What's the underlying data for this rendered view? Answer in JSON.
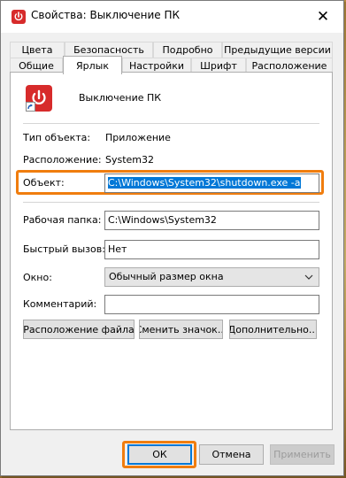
{
  "window": {
    "title": "Свойства: Выключение ПК",
    "close_glyph": "✕"
  },
  "tabs": {
    "row1": [
      "Цвета",
      "Безопасность",
      "Подробно",
      "Предыдущие версии"
    ],
    "row2": [
      "Общие",
      "Ярлык",
      "Настройки",
      "Шрифт",
      "Расположение"
    ],
    "active": "Ярлык"
  },
  "shortcut": {
    "name": "Выключение ПК",
    "icon": "power-icon",
    "overlay_icon": "shortcut-arrow-icon"
  },
  "info": {
    "type_label": "Тип объекта:",
    "type_value": "Приложение",
    "location_label": "Расположение:",
    "location_value": "System32"
  },
  "fields": {
    "target_label": "Объект:",
    "target_value": "C:\\Windows\\System32\\shutdown.exe -a",
    "workdir_label": "Рабочая папка:",
    "workdir_value": "C:\\Windows\\System32",
    "hotkey_label": "Быстрый вызов:",
    "hotkey_value": "Нет",
    "run_label": "Окно:",
    "run_value": "Обычный размер окна",
    "comment_label": "Комментарий:",
    "comment_value": ""
  },
  "panel_buttons": {
    "open_location": "Расположение файла",
    "change_icon": "Сменить значок...",
    "advanced": "Дополнительно..."
  },
  "dialog_buttons": {
    "ok": "ОК",
    "cancel": "Отмена",
    "apply": "Применить"
  },
  "colors": {
    "highlight": "#f07d0e",
    "selection": "#0078d7",
    "icon_red": "#d72b2b"
  }
}
